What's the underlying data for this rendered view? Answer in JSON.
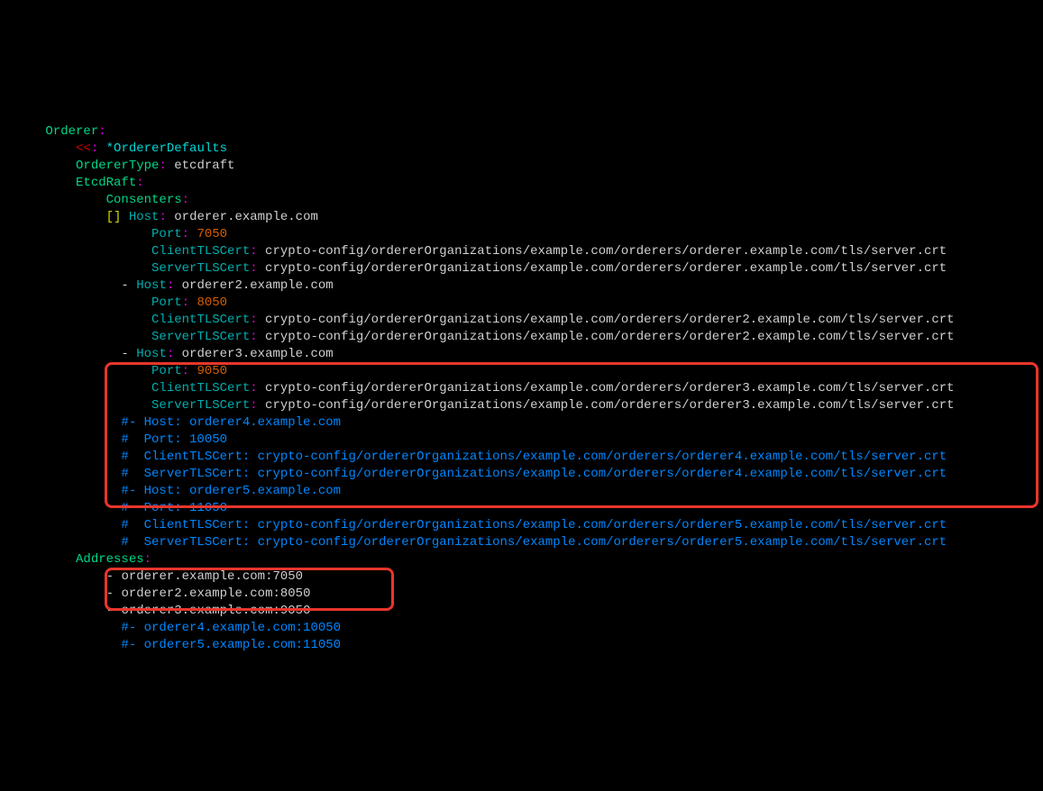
{
  "indent": {
    "i1": "      ",
    "i2": "          ",
    "i3": "              ",
    "i4": "                ",
    "i5": "                    "
  },
  "lines": [
    {
      "type": "partial",
      "indent": "i1",
      "segs": [
        {
          "cls": "key-green",
          "txt": ""
        }
      ]
    },
    {
      "type": "kv",
      "indent": "i1",
      "key": "Orderer",
      "keycls": "key-green",
      "val": ""
    },
    {
      "type": "merge",
      "indent": "i2",
      "key": "<<",
      "ref": "*OrdererDefaults"
    },
    {
      "type": "kv",
      "indent": "i2",
      "key": "OrdererType",
      "keycls": "key-green",
      "val": " etcdraft",
      "valcls": "val-white"
    },
    {
      "type": "kv",
      "indent": "i2",
      "key": "EtcdRaft",
      "keycls": "key-green",
      "val": ""
    },
    {
      "type": "kv",
      "indent": "i3",
      "key": "Consenters",
      "keycls": "key-green",
      "val": ""
    },
    {
      "type": "kvbr",
      "indent": "i3",
      "pre": "[]",
      "dash": "",
      "key": " Host",
      "keycls": "key-cyan",
      "val": " orderer.example.com",
      "valcls": "val-white"
    },
    {
      "type": "kv",
      "indent": "i5",
      "key": "Port",
      "keycls": "key-cyan",
      "val": " 7050",
      "valcls": "val-redish"
    },
    {
      "type": "kv",
      "indent": "i5",
      "key": "ClientTLSCert",
      "keycls": "key-cyan",
      "val": " crypto-config/ordererOrganizations/example.com/orderers/orderer.example.com/tls/server.crt",
      "valcls": "val-white"
    },
    {
      "type": "kv",
      "indent": "i5",
      "key": "ServerTLSCert",
      "keycls": "key-cyan",
      "val": " crypto-config/ordererOrganizations/example.com/orderers/orderer.example.com/tls/server.crt",
      "valcls": "val-white"
    },
    {
      "type": "kvdash",
      "indent": "i4",
      "key": "Host",
      "keycls": "key-cyan",
      "val": " orderer2.example.com",
      "valcls": "val-white"
    },
    {
      "type": "kv",
      "indent": "i5",
      "key": "Port",
      "keycls": "key-cyan",
      "val": " 8050",
      "valcls": "val-redish"
    },
    {
      "type": "kv",
      "indent": "i5",
      "key": "ClientTLSCert",
      "keycls": "key-cyan",
      "val": " crypto-config/ordererOrganizations/example.com/orderers/orderer2.example.com/tls/server.crt",
      "valcls": "val-white"
    },
    {
      "type": "kv",
      "indent": "i5",
      "key": "ServerTLSCert",
      "keycls": "key-cyan",
      "val": " crypto-config/ordererOrganizations/example.com/orderers/orderer2.example.com/tls/server.crt",
      "valcls": "val-white"
    },
    {
      "type": "kvdash",
      "indent": "i4",
      "key": "Host",
      "keycls": "key-cyan",
      "val": " orderer3.example.com",
      "valcls": "val-white"
    },
    {
      "type": "kv",
      "indent": "i5",
      "key": "Port",
      "keycls": "key-cyan",
      "val": " 9050",
      "valcls": "val-redish"
    },
    {
      "type": "kv",
      "indent": "i5",
      "key": "ClientTLSCert",
      "keycls": "key-cyan",
      "val": " crypto-config/ordererOrganizations/example.com/orderers/orderer3.example.com/tls/server.crt",
      "valcls": "val-white"
    },
    {
      "type": "kv",
      "indent": "i5",
      "key": "ServerTLSCert",
      "keycls": "key-cyan",
      "val": " crypto-config/ordererOrganizations/example.com/orderers/orderer3.example.com/tls/server.crt",
      "valcls": "val-white"
    },
    {
      "type": "comment",
      "indent": "i4",
      "txt": "#- Host: orderer4.example.com"
    },
    {
      "type": "comment",
      "indent": "i4",
      "txt": "#  Port: 10050"
    },
    {
      "type": "comment",
      "indent": "i4",
      "txt": "#  ClientTLSCert: crypto-config/ordererOrganizations/example.com/orderers/orderer4.example.com/tls/server.crt"
    },
    {
      "type": "comment",
      "indent": "i4",
      "txt": "#  ServerTLSCert: crypto-config/ordererOrganizations/example.com/orderers/orderer4.example.com/tls/server.crt"
    },
    {
      "type": "comment",
      "indent": "i4",
      "txt": "#- Host: orderer5.example.com"
    },
    {
      "type": "comment",
      "indent": "i4",
      "txt": "#  Port: 11050"
    },
    {
      "type": "comment",
      "indent": "i4",
      "txt": "#  ClientTLSCert: crypto-config/ordererOrganizations/example.com/orderers/orderer5.example.com/tls/server.crt"
    },
    {
      "type": "comment",
      "indent": "i4",
      "txt": "#  ServerTLSCert: crypto-config/ordererOrganizations/example.com/orderers/orderer5.example.com/tls/server.crt"
    },
    {
      "type": "kv",
      "indent": "i2",
      "key": "Addresses",
      "keycls": "key-green",
      "val": ""
    },
    {
      "type": "listitem",
      "indent": "i3",
      "txt": "orderer.example.com:7050"
    },
    {
      "type": "listitem",
      "indent": "i3",
      "txt": "orderer2.example.com:8050"
    },
    {
      "type": "listitem",
      "indent": "i3",
      "txt": "orderer3.example.com:9050"
    },
    {
      "type": "comment",
      "indent": "i3",
      "txt": "  #- orderer4.example.com:10050"
    },
    {
      "type": "comment",
      "indent": "i3",
      "txt": "  #- orderer5.example.com:11050"
    }
  ]
}
